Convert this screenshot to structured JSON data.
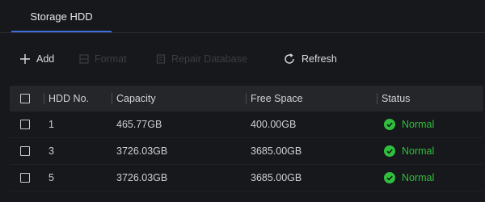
{
  "tabs": [
    {
      "label": "Storage HDD"
    }
  ],
  "toolbar": {
    "add": "Add",
    "format": "Format",
    "repair": "Repair Database",
    "refresh": "Refresh"
  },
  "table": {
    "headers": [
      "HDD No.",
      "Capacity",
      "Free Space",
      "Status"
    ],
    "rows": [
      {
        "hdd_no": "1",
        "capacity": "465.77GB",
        "free_space": "400.00GB",
        "status": "Normal"
      },
      {
        "hdd_no": "3",
        "capacity": "3726.03GB",
        "free_space": "3685.00GB",
        "status": "Normal"
      },
      {
        "hdd_no": "5",
        "capacity": "3726.03GB",
        "free_space": "3685.00GB",
        "status": "Normal"
      }
    ]
  },
  "icons": {
    "add": "plus-icon",
    "format": "format-icon",
    "repair": "repair-database-icon",
    "refresh": "refresh-icon",
    "status": "check-circle-icon"
  },
  "colors": {
    "accent": "#3d6fd6",
    "status_ok": "#2fbf3d",
    "disabled": "#3c3e43"
  }
}
